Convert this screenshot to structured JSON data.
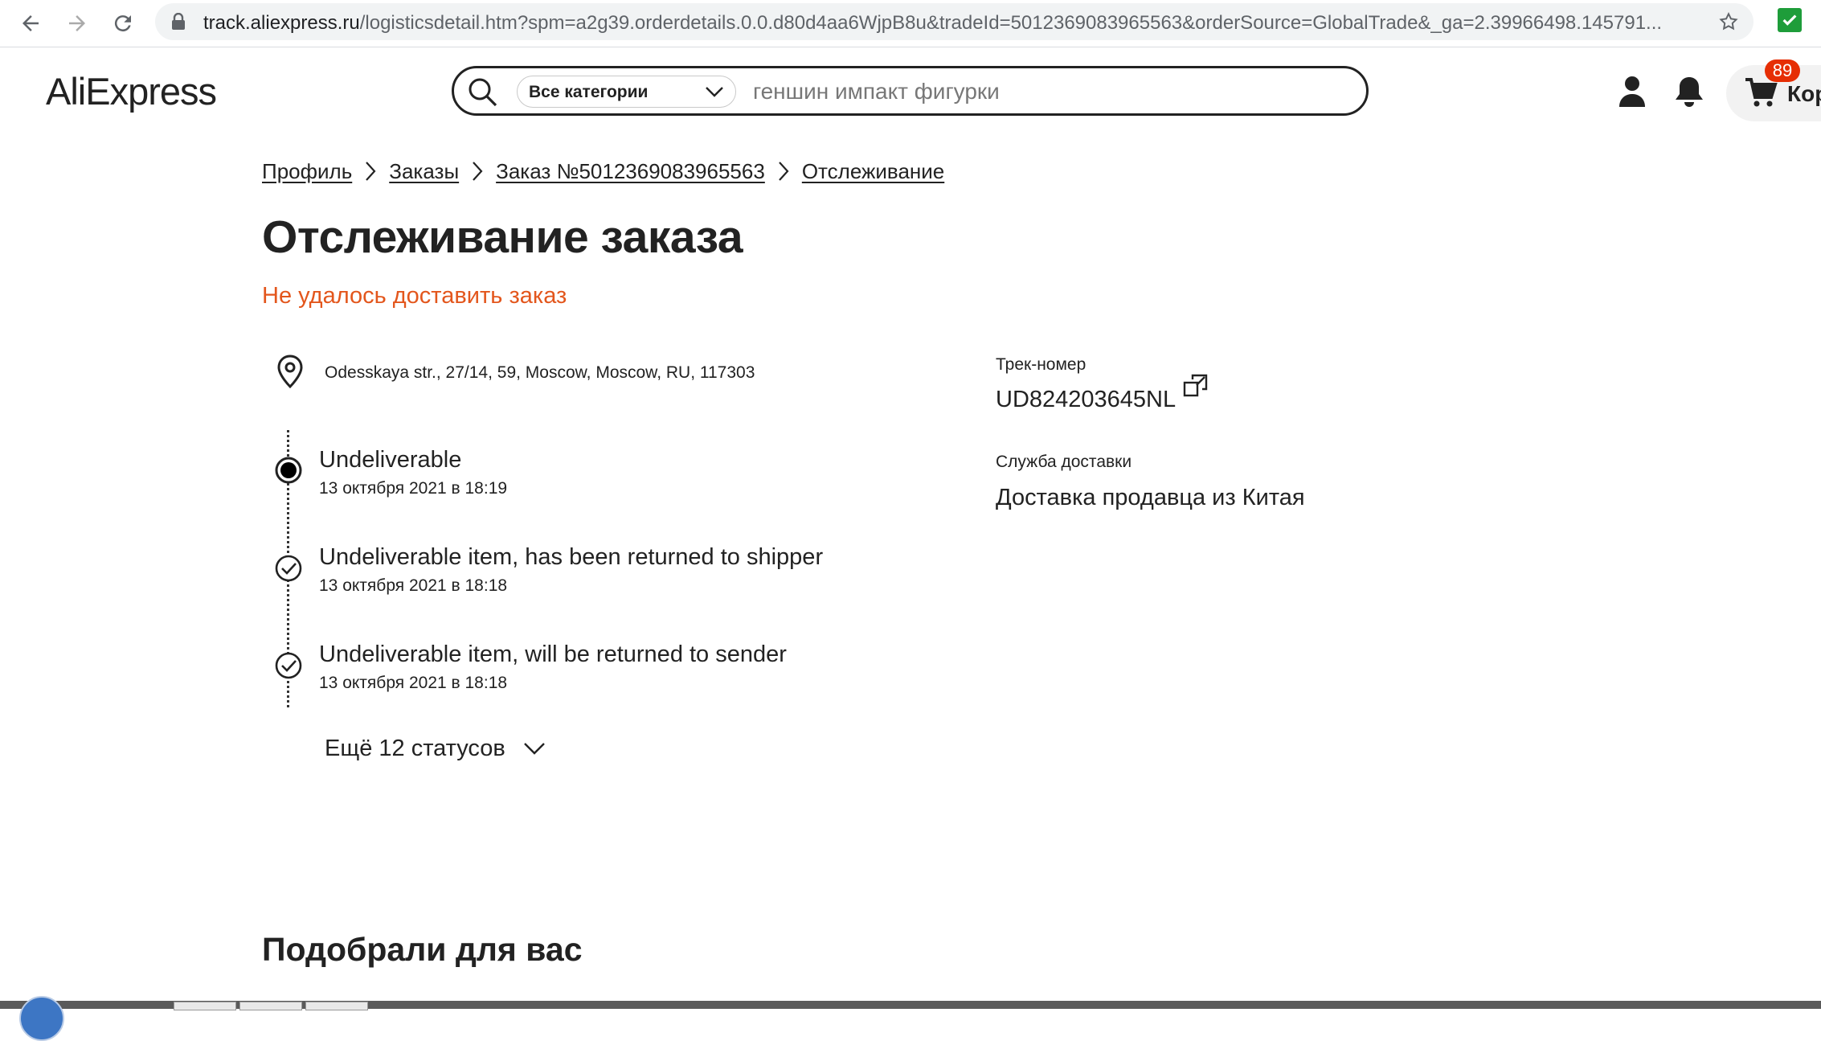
{
  "browser": {
    "url_host": "track.aliexpress.ru",
    "url_rest": "/logisticsdetail.htm?spm=a2g39.orderdetails.0.0.d80d4aa6WjpB8u&tradeId=5012369083965563&orderSource=GlobalTrade&_ga=2.39966498.145791...",
    "icons": [
      "back-icon",
      "forward-icon",
      "reload-icon",
      "lock-icon",
      "star-icon",
      "extension-check-icon"
    ]
  },
  "header": {
    "logo": "AliExpress",
    "search": {
      "category": "Все категории",
      "placeholder": "геншин импакт фигурки"
    },
    "cart": {
      "badge": "89",
      "label": "Кор"
    }
  },
  "breadcrumb": [
    "Профиль",
    "Заказы",
    "Заказ №5012369083965563",
    "Отслеживание"
  ],
  "main": {
    "title": "Отслеживание заказа",
    "status": "Не удалось доставить заказ",
    "status_color": "#e3561c",
    "address": "Odesskaya str., 27/14, 59, Moscow, Moscow, RU, 117303",
    "timeline": [
      {
        "title": "Undeliverable",
        "date": "13 октября 2021 в 18:19"
      },
      {
        "title": "Undeliverable item, has been returned to shipper",
        "date": "13 октября 2021 в 18:18"
      },
      {
        "title": "Undeliverable item, will be returned to sender",
        "date": "13 октября 2021 в 18:18"
      }
    ],
    "more_label": "Ещё 12 статусов",
    "track": {
      "label": "Трек-номер",
      "value": "UD824203645NL"
    },
    "carrier": {
      "label": "Служба доставки",
      "value": "Доставка продавца из Китая"
    },
    "recommend_title": "Подобрали для вас"
  }
}
